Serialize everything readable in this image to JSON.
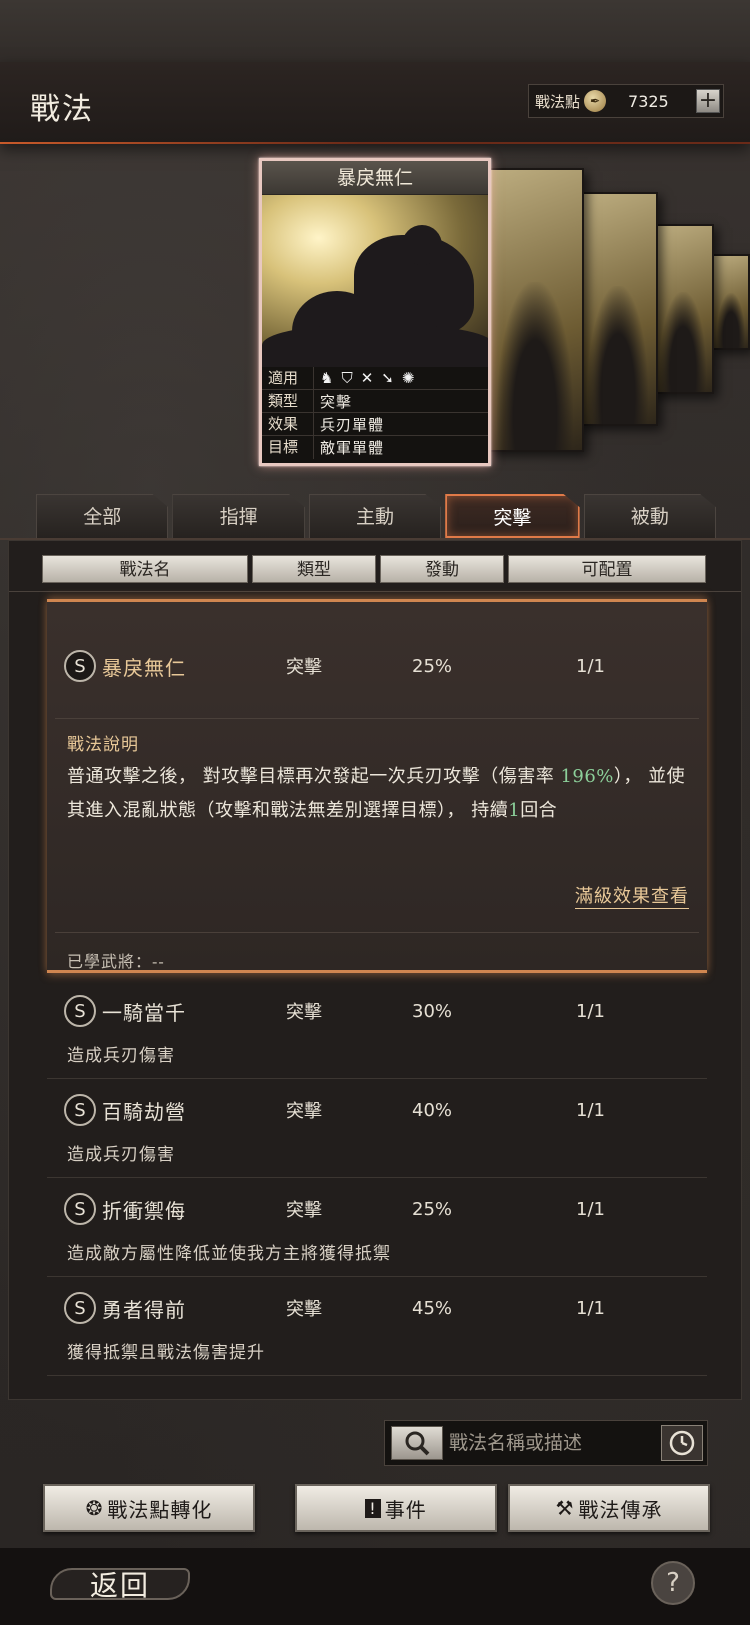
{
  "header": {
    "title": "戰法",
    "points_label": "戰法點",
    "points_value": "7325",
    "plus": "+"
  },
  "card": {
    "name": "暴戾無仁",
    "rows": [
      {
        "key": "適用",
        "value": ""
      },
      {
        "key": "類型",
        "value": "突擊"
      },
      {
        "key": "效果",
        "value": "兵刃單體"
      },
      {
        "key": "目標",
        "value": "敵軍單體"
      }
    ],
    "unit_icons": [
      "cavalry-icon",
      "shield-icon",
      "bow-icon",
      "spear-icon",
      "wheel-icon"
    ]
  },
  "tabs": [
    {
      "label": "全部",
      "active": false
    },
    {
      "label": "指揮",
      "active": false
    },
    {
      "label": "主動",
      "active": false
    },
    {
      "label": "突擊",
      "active": true
    },
    {
      "label": "被動",
      "active": false
    }
  ],
  "columns": [
    "戰法名",
    "類型",
    "發動",
    "可配置"
  ],
  "selected": {
    "grade": "S",
    "name": "暴戾無仁",
    "type": "突擊",
    "rate": "25%",
    "slots": "1/1",
    "desc_title": "戰法說明",
    "desc_part1": "普通攻擊之後， 對攻擊目標再次發起一次兵刃攻擊（傷害率 ",
    "desc_hl1": "196%",
    "desc_part2": "）， 並使其進入混亂狀態（攻擊和戰法無差別選擇目標）， 持續",
    "desc_hl2": "1",
    "desc_part3": "回合",
    "max_link": "滿級效果查看",
    "learned": "已學武將：--"
  },
  "items": [
    {
      "grade": "S",
      "name": "一騎當千",
      "type": "突擊",
      "rate": "30%",
      "slots": "1/1",
      "desc": "造成兵刃傷害"
    },
    {
      "grade": "S",
      "name": "百騎劫營",
      "type": "突擊",
      "rate": "40%",
      "slots": "1/1",
      "desc": "造成兵刃傷害"
    },
    {
      "grade": "S",
      "name": "折衝禦侮",
      "type": "突擊",
      "rate": "25%",
      "slots": "1/1",
      "desc": "造成敵方屬性降低並使我方主將獲得抵禦"
    },
    {
      "grade": "S",
      "name": "勇者得前",
      "type": "突擊",
      "rate": "45%",
      "slots": "1/1",
      "desc": "獲得抵禦且戰法傷害提升"
    }
  ],
  "search": {
    "placeholder": "戰法名稱或描述"
  },
  "buttons": {
    "convert": "戰法點轉化",
    "event": "事件",
    "inherit": "戰法傳承"
  },
  "footer": {
    "back": "返回",
    "help": "?"
  },
  "colors": {
    "accent": "#e07a48",
    "gold_text": "#e8c898",
    "highlight": "#8cd09a"
  }
}
